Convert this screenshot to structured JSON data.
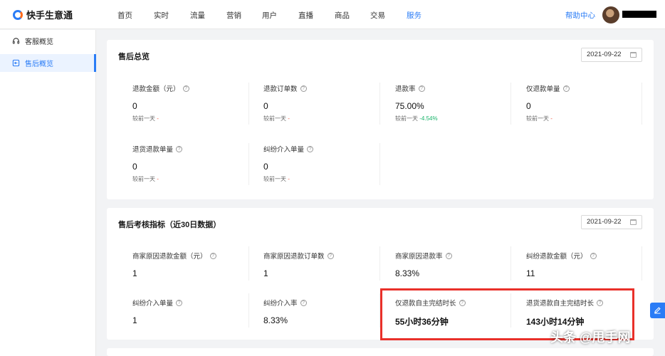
{
  "app": {
    "name": "快手生意通"
  },
  "nav": {
    "items": [
      "首页",
      "实时",
      "流量",
      "营销",
      "用户",
      "直播",
      "商品",
      "交易",
      "服务"
    ],
    "active": "服务",
    "help": "帮助中心"
  },
  "sidebar": {
    "items": [
      {
        "label": "客服概览",
        "icon": "headset-icon"
      },
      {
        "label": "售后概览",
        "icon": "return-icon"
      }
    ],
    "active": "售后概览"
  },
  "summary": {
    "title": "售后总览",
    "date": "2021-09-22",
    "compare_label": "较前一天",
    "metrics": [
      {
        "label": "退款金额（元）",
        "value": "0",
        "change": "-"
      },
      {
        "label": "退款订单数",
        "value": "0",
        "change": "-"
      },
      {
        "label": "退款率",
        "value": "75.00%",
        "change": "-4.54%"
      },
      {
        "label": "仅退款单量",
        "value": "0",
        "change": "-"
      },
      {
        "label": "退货退款单量",
        "value": "0",
        "change": "-"
      },
      {
        "label": "纠纷介入单量",
        "value": "0",
        "change": "-"
      }
    ]
  },
  "assessment": {
    "title": "售后考核指标（近30日数据）",
    "date": "2021-09-22",
    "metrics": [
      {
        "label": "商家原因退款金额（元）",
        "value": "1"
      },
      {
        "label": "商家原因退款订单数",
        "value": "1"
      },
      {
        "label": "商家原因退款率",
        "value": "8.33%"
      },
      {
        "label": "纠纷退款金额（元）",
        "value": "11"
      },
      {
        "label": "纠纷介入单量",
        "value": "1"
      },
      {
        "label": "纠纷介入率",
        "value": "8.33%"
      },
      {
        "label": "仅退款自主完结时长",
        "value": "55小时36分钟"
      },
      {
        "label": "退货退款自主完结时长",
        "value": "143小时14分钟"
      }
    ]
  },
  "colors": {
    "accent": "#2a7cf6",
    "highlight": "#e9302a",
    "down": "#19b46a"
  },
  "watermark": "头条 @甩手网"
}
